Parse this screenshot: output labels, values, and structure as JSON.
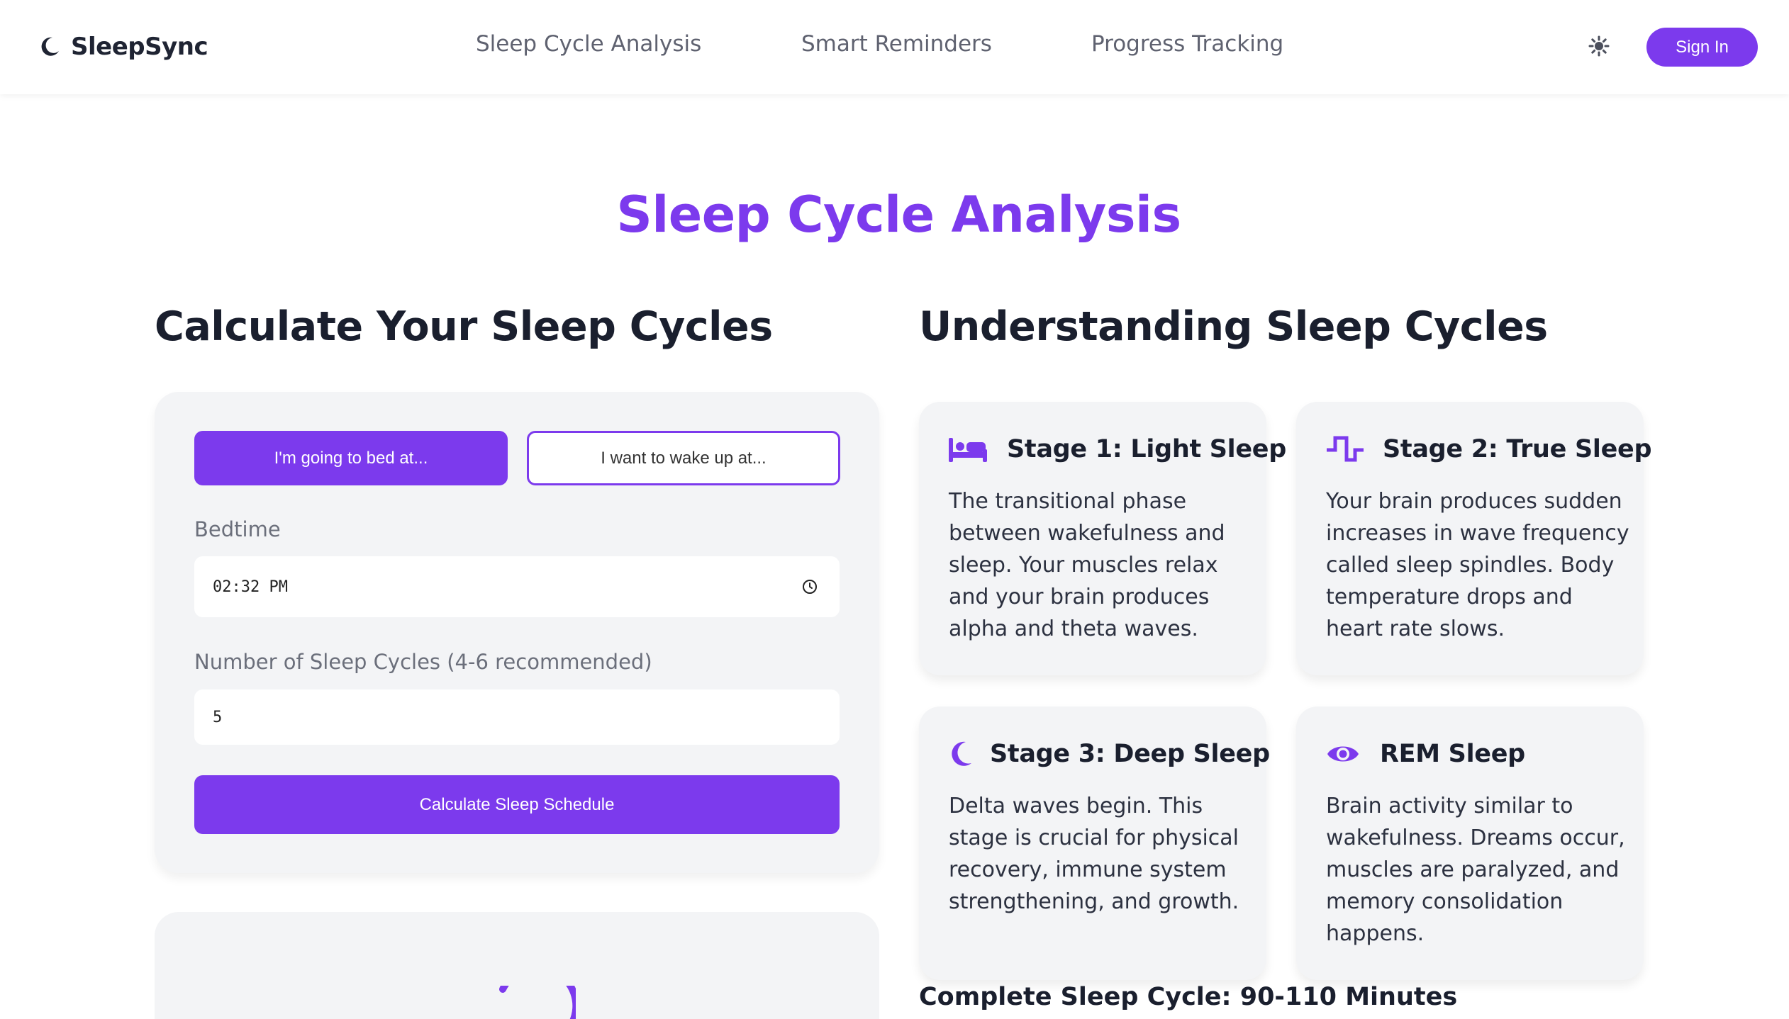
{
  "nav": {
    "brand": "SleepSync",
    "links": [
      "Sleep Cycle Analysis",
      "Smart Reminders",
      "Progress Tracking"
    ],
    "sign_in": "Sign In"
  },
  "page": {
    "title": "Sleep Cycle Analysis"
  },
  "calculator": {
    "heading": "Calculate Your Sleep Cycles",
    "mode_bed": "I'm going to bed at...",
    "mode_wake": "I want to wake up at...",
    "bedtime_label": "Bedtime",
    "bedtime_value": "02:32 PM",
    "cycles_label": "Number of Sleep Cycles (4-6 recommended)",
    "cycles_value": "5",
    "submit": "Calculate Sleep Schedule"
  },
  "understanding": {
    "heading": "Understanding Sleep Cycles",
    "stages": [
      {
        "icon": "bed-icon",
        "title": "Stage 1: Light Sleep",
        "description": "The transitional phase between wakefulness and sleep. Your muscles relax and your brain produces alpha and theta waves."
      },
      {
        "icon": "wave-icon",
        "title": "Stage 2: True Sleep",
        "description": "Your brain produces sudden increases in wave frequency called sleep spindles. Body temperature drops and heart rate slows."
      },
      {
        "icon": "moon-icon",
        "title": "Stage 3: Deep Sleep",
        "description": "Delta waves begin. This stage is crucial for physical recovery, immune system strengthening, and growth."
      },
      {
        "icon": "eye-icon",
        "title": "REM Sleep",
        "description": "Brain activity similar to wakefulness. Dreams occur, muscles are paralyzed, and memory consolidation happens."
      }
    ],
    "cycle_note": "Complete Sleep Cycle: 90-110 Minutes"
  },
  "colors": {
    "accent": "#7c3aed",
    "card_bg": "#f3f4f6",
    "text_dark": "#1a1f2e"
  }
}
